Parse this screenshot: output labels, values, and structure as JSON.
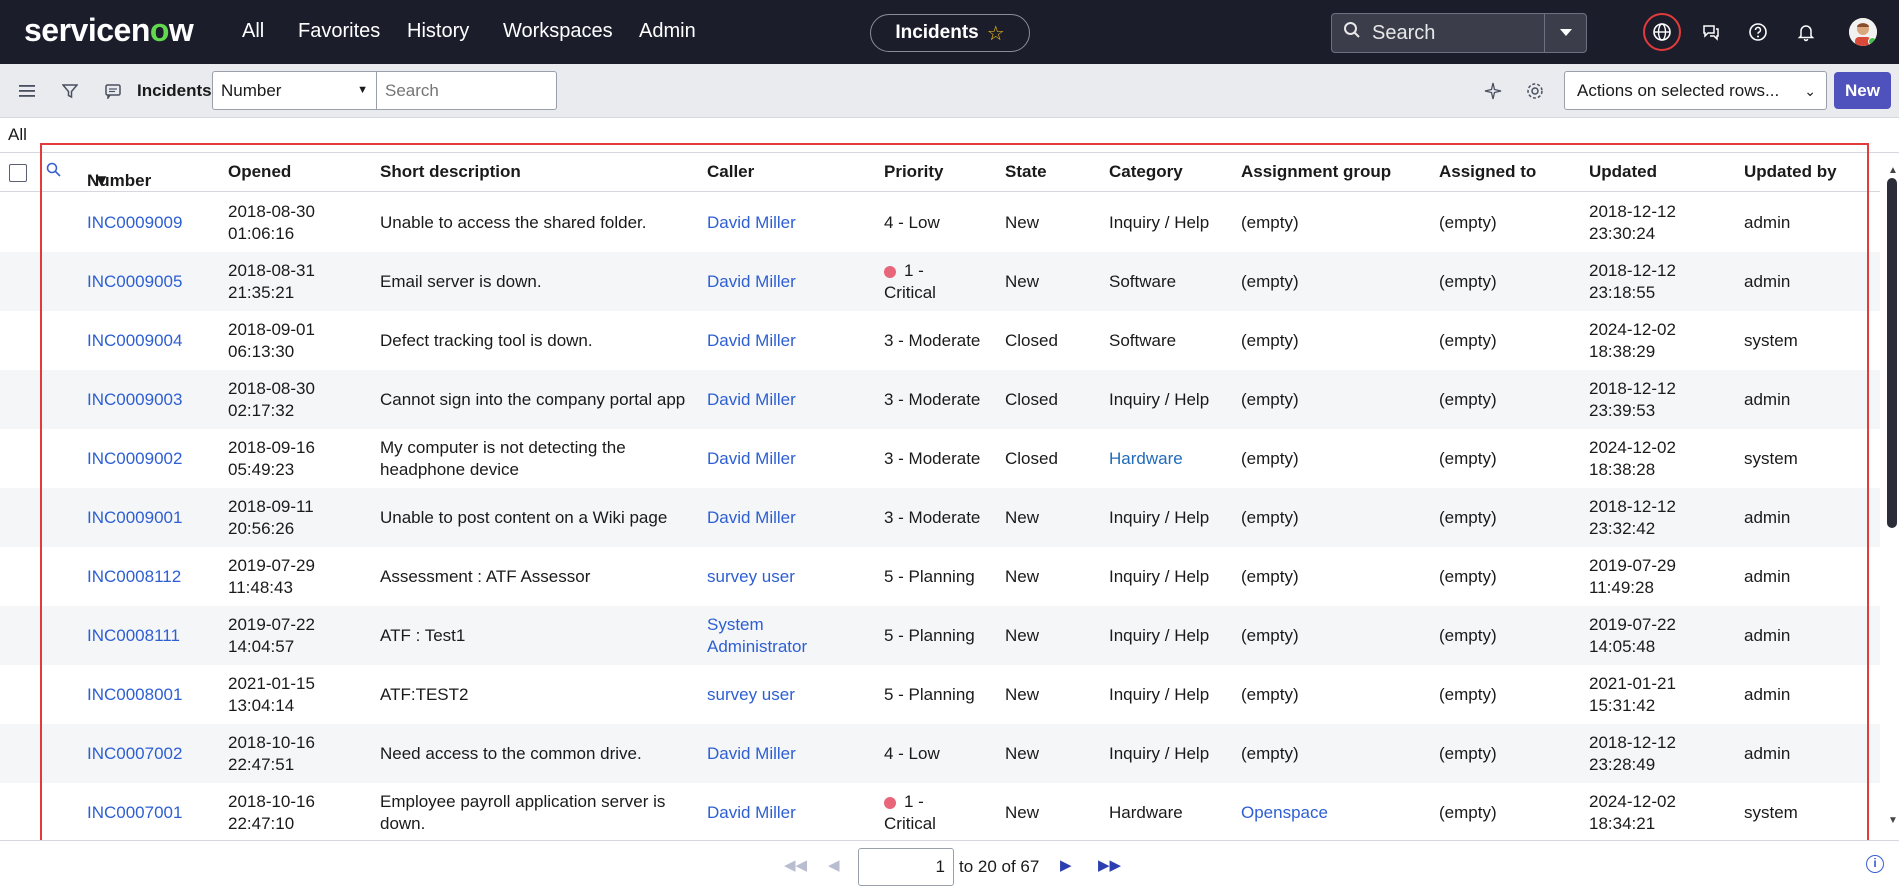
{
  "nav": {
    "logo_main": "servicen",
    "logo_o": "o",
    "logo_end": "w",
    "menu": [
      "All",
      "Favorites",
      "History",
      "Workspaces",
      "Admin"
    ],
    "context_title": "Incidents",
    "search_placeholder": "Search",
    "icons": [
      "globe-icon",
      "chat-icon",
      "help-icon",
      "bell-icon",
      "avatar"
    ]
  },
  "toolbar": {
    "title": "Incidents",
    "field_select": "Number",
    "search_placeholder": "Search",
    "actions_select": "Actions on selected rows...",
    "new_label": "New"
  },
  "breadcrumb": "All",
  "columns": [
    "Number",
    "Opened",
    "Short description",
    "Caller",
    "Priority",
    "State",
    "Category",
    "Assignment group",
    "Assigned to",
    "Updated",
    "Updated by"
  ],
  "rows": [
    {
      "number": "INC0009009",
      "opened_date": "2018-08-30",
      "opened_time": "01:06:16",
      "desc1": "Unable to access the shared folder.",
      "desc2": "",
      "caller1": "David Miller",
      "caller2": "",
      "prio1": "4 - Low",
      "prio2": "",
      "critical": false,
      "state": "New",
      "category": "Inquiry / Help",
      "category_link": false,
      "group": "(empty)",
      "group_link": false,
      "assigned": "(empty)",
      "upd_date": "2018-12-12",
      "upd_time": "23:30:24",
      "upd_by": "admin"
    },
    {
      "number": "INC0009005",
      "opened_date": "2018-08-31",
      "opened_time": "21:35:21",
      "desc1": "Email server is down.",
      "desc2": "",
      "caller1": "David Miller",
      "caller2": "",
      "prio1": "1 -",
      "prio2": "Critical",
      "critical": true,
      "state": "New",
      "category": "Software",
      "category_link": false,
      "group": "(empty)",
      "group_link": false,
      "assigned": "(empty)",
      "upd_date": "2018-12-12",
      "upd_time": "23:18:55",
      "upd_by": "admin"
    },
    {
      "number": "INC0009004",
      "opened_date": "2018-09-01",
      "opened_time": "06:13:30",
      "desc1": "Defect tracking tool is down.",
      "desc2": "",
      "caller1": "David Miller",
      "caller2": "",
      "prio1": "3 - Moderate",
      "prio2": "",
      "critical": false,
      "state": "Closed",
      "category": "Software",
      "category_link": false,
      "group": "(empty)",
      "group_link": false,
      "assigned": "(empty)",
      "upd_date": "2024-12-02",
      "upd_time": "18:38:29",
      "upd_by": "system"
    },
    {
      "number": "INC0009003",
      "opened_date": "2018-08-30",
      "opened_time": "02:17:32",
      "desc1": "Cannot sign into the company portal app",
      "desc2": "",
      "caller1": "David Miller",
      "caller2": "",
      "prio1": "3 - Moderate",
      "prio2": "",
      "critical": false,
      "state": "Closed",
      "category": "Inquiry / Help",
      "category_link": false,
      "group": "(empty)",
      "group_link": false,
      "assigned": "(empty)",
      "upd_date": "2018-12-12",
      "upd_time": "23:39:53",
      "upd_by": "admin"
    },
    {
      "number": "INC0009002",
      "opened_date": "2018-09-16",
      "opened_time": "05:49:23",
      "desc1": "My computer is not detecting the",
      "desc2": "headphone device",
      "caller1": "David Miller",
      "caller2": "",
      "prio1": "3 - Moderate",
      "prio2": "",
      "critical": false,
      "state": "Closed",
      "category": "Hardware",
      "category_link": true,
      "group": "(empty)",
      "group_link": false,
      "assigned": "(empty)",
      "upd_date": "2024-12-02",
      "upd_time": "18:38:28",
      "upd_by": "system"
    },
    {
      "number": "INC0009001",
      "opened_date": "2018-09-11",
      "opened_time": "20:56:26",
      "desc1": "Unable to post content on a Wiki page",
      "desc2": "",
      "caller1": "David Miller",
      "caller2": "",
      "prio1": "3 - Moderate",
      "prio2": "",
      "critical": false,
      "state": "New",
      "category": "Inquiry / Help",
      "category_link": false,
      "group": "(empty)",
      "group_link": false,
      "assigned": "(empty)",
      "upd_date": "2018-12-12",
      "upd_time": "23:32:42",
      "upd_by": "admin"
    },
    {
      "number": "INC0008112",
      "opened_date": "2019-07-29",
      "opened_time": "11:48:43",
      "desc1": "Assessment : ATF Assessor",
      "desc2": "",
      "caller1": "survey user",
      "caller2": "",
      "prio1": "5 - Planning",
      "prio2": "",
      "critical": false,
      "state": "New",
      "category": "Inquiry / Help",
      "category_link": false,
      "group": "(empty)",
      "group_link": false,
      "assigned": "(empty)",
      "upd_date": "2019-07-29",
      "upd_time": "11:49:28",
      "upd_by": "admin"
    },
    {
      "number": "INC0008111",
      "opened_date": "2019-07-22",
      "opened_time": "14:04:57",
      "desc1": "ATF : Test1",
      "desc2": "",
      "caller1": "System",
      "caller2": "Administrator",
      "prio1": "5 - Planning",
      "prio2": "",
      "critical": false,
      "state": "New",
      "category": "Inquiry / Help",
      "category_link": false,
      "group": "(empty)",
      "group_link": false,
      "assigned": "(empty)",
      "upd_date": "2019-07-22",
      "upd_time": "14:05:48",
      "upd_by": "admin"
    },
    {
      "number": "INC0008001",
      "opened_date": "2021-01-15",
      "opened_time": "13:04:14",
      "desc1": "ATF:TEST2",
      "desc2": "",
      "caller1": "survey user",
      "caller2": "",
      "prio1": "5 - Planning",
      "prio2": "",
      "critical": false,
      "state": "New",
      "category": "Inquiry / Help",
      "category_link": false,
      "group": "(empty)",
      "group_link": false,
      "assigned": "(empty)",
      "upd_date": "2021-01-21",
      "upd_time": "15:31:42",
      "upd_by": "admin"
    },
    {
      "number": "INC0007002",
      "opened_date": "2018-10-16",
      "opened_time": "22:47:51",
      "desc1": "Need access to the common drive.",
      "desc2": "",
      "caller1": "David Miller",
      "caller2": "",
      "prio1": "4 - Low",
      "prio2": "",
      "critical": false,
      "state": "New",
      "category": "Inquiry / Help",
      "category_link": false,
      "group": "(empty)",
      "group_link": false,
      "assigned": "(empty)",
      "upd_date": "2018-12-12",
      "upd_time": "23:28:49",
      "upd_by": "admin"
    },
    {
      "number": "INC0007001",
      "opened_date": "2018-10-16",
      "opened_time": "22:47:10",
      "desc1": "Employee payroll application server is",
      "desc2": "down.",
      "caller1": "David Miller",
      "caller2": "",
      "prio1": "1 -",
      "prio2": "Critical",
      "critical": true,
      "state": "New",
      "category": "Hardware",
      "category_link": false,
      "group": "Openspace",
      "group_link": true,
      "assigned": "(empty)",
      "upd_date": "2024-12-02",
      "upd_time": "18:34:21",
      "upd_by": "system"
    }
  ],
  "pagination": {
    "current_page": "1",
    "range_text": "to 20 of 67"
  },
  "colors": {
    "nav_bg": "#1b1d2b",
    "link": "#2d5fd3",
    "new_button": "#4f52bd",
    "critical": "#e8657a",
    "highlight": "#e23b3b"
  }
}
